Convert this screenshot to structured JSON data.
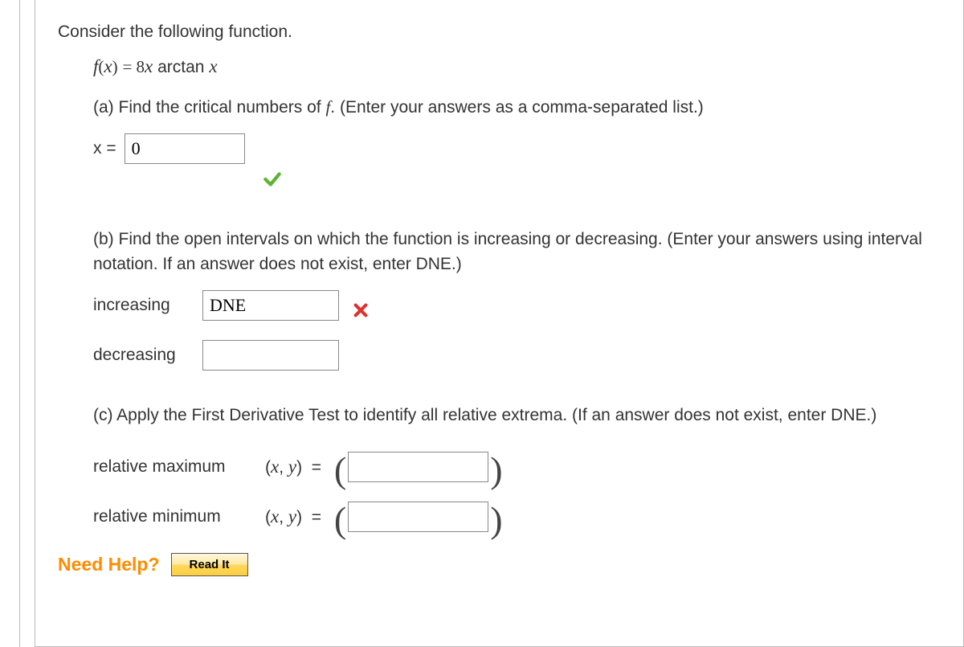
{
  "prompt": "Consider the following function.",
  "function_lhs": "f",
  "function_arg": "x",
  "function_rhs_num": "8",
  "function_rhs_var": "x",
  "function_rhs_fn": "arctan",
  "function_rhs_arg": "x",
  "partA": {
    "text": "(a) Find the critical numbers of f. (Enter your answers as a comma-separated list.)",
    "label": "x =",
    "value": "0"
  },
  "partB": {
    "text": "(b) Find the open intervals on which the function is increasing or decreasing. (Enter your answers using interval notation. If an answer does not exist, enter DNE.)",
    "increasing_label": "increasing",
    "increasing_value": "DNE",
    "decreasing_label": "decreasing",
    "decreasing_value": ""
  },
  "partC": {
    "text": "(c) Apply the First Derivative Test to identify all relative extrema. (If an answer does not exist, enter DNE.)",
    "relmax_label": "relative maximum",
    "relmin_label": "relative minimum",
    "xy_label_x": "x",
    "xy_label_y": "y",
    "relmax_value": "",
    "relmin_value": ""
  },
  "help": {
    "label": "Need Help?",
    "read_it": "Read It"
  }
}
